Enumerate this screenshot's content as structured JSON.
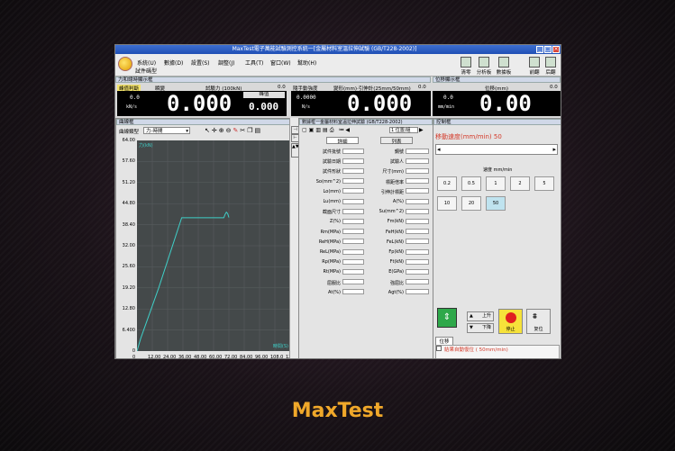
{
  "window": {
    "title": "MaxTest電子萬能試驗測控系統一[金屬材料室溫拉伸試驗 (GB/T228-2002)]"
  },
  "menu": {
    "items": [
      "系統(U)",
      "數據(D)",
      "設置(S)",
      "調整(J)",
      "工具(T)",
      "窗口(W)",
      "幫助(H)"
    ],
    "sub_label": "試件碼型",
    "toolbar": [
      "清零",
      "分析板",
      "數據板",
      "前翻",
      "后翻"
    ]
  },
  "force_section": {
    "title": "力和總時顯示框",
    "mode_button": "峰值判斷",
    "peak_label": "瞬變",
    "force_label": "試驗力 (100kN)",
    "force_zero": "0.0",
    "force_value": "0.000",
    "force_small": "0.0",
    "force_unit": "kN/s",
    "peak_title": "峰值",
    "peak_value": "0.000"
  },
  "deform_section": {
    "mode": "隨手動強度",
    "label": "變形(mm)·引伸計(25mm/50mm)",
    "zero": "0.0",
    "value": "0.000",
    "small": "0.0000",
    "unit": "N/s"
  },
  "disp_section": {
    "title": "位移顯示框",
    "label": "位移(mm)",
    "zero": "0.0",
    "value": "0.00",
    "small": "0.0",
    "unit": "mm/min"
  },
  "curve": {
    "title": "曲線框",
    "type_label": "曲線類型",
    "type_value": "力-時間",
    "y_axis_label": "力(kN)",
    "x_axis_label": "時間(S)",
    "y_ticks": [
      "64.00",
      "57.60",
      "51.20",
      "44.80",
      "38.40",
      "32.00",
      "25.60",
      "19.20",
      "12.80",
      "6.400",
      "0"
    ],
    "x_ticks": [
      "0",
      "12.00",
      "24.00",
      "36.00",
      "48.00",
      "60.00",
      "72.00",
      "84.00",
      "96.00",
      "108.0",
      "120.0"
    ]
  },
  "chart_data": {
    "type": "line",
    "xlabel": "時間(S)",
    "ylabel": "力(kN)",
    "xlim": [
      0,
      120
    ],
    "ylim": [
      0,
      64
    ],
    "grid": true,
    "series": [
      {
        "name": "",
        "x": [
          0,
          3,
          17,
          35,
          57,
          68,
          69,
          70,
          71,
          71.5,
          72
        ],
        "y": [
          0,
          4,
          19.2,
          40.5,
          40.5,
          40.5,
          41.5,
          42.2,
          41.8,
          41.2,
          40.6
        ]
      }
    ]
  },
  "form_section": {
    "title": "數據框一金屬材料室溫拉伸試驗 (GB/T228-2002)",
    "nav_value": "1 位置/組",
    "tabs": [
      "詳細",
      "列表"
    ],
    "left_fields": [
      "試件批號",
      "試驗日期",
      "試件形狀",
      "So(mm^2)",
      "Lo(mm)",
      "Lu(mm)",
      "截面尺寸",
      "Z(%)",
      "Rm(MPa)",
      "ReH(MPa)",
      "ReL(MPa)",
      "Rp(MPa)",
      "Rt(MPa)",
      "屈服比",
      "At(%)"
    ],
    "right_fields": [
      "鋼號",
      "試驗人",
      "尺寸(mm)",
      "標距倍率",
      "引伸計標距",
      "A(%)",
      "Su(mm^2)",
      "Fm(kN)",
      "FeH(kN)",
      "FeL(kN)",
      "Fp(kN)",
      "Ft(kN)",
      "E(GPa)",
      "強屈比",
      "Agt(%)"
    ]
  },
  "control_section": {
    "title": "控制框",
    "speed_label": "移動速度(mm/min) 50",
    "speed_header": "速度 mm/min",
    "speeds": [
      "0.2",
      "0.5",
      "1",
      "2",
      "5",
      "10",
      "20",
      "50"
    ],
    "selected_speed": "50",
    "tab": "位移",
    "up_label": "上升",
    "down_label": "下降",
    "stop_label": "停止",
    "reset_label": "复位",
    "auto_return_label": "結果自動復位 ( 50mm/min)"
  },
  "caption": "MaxTest",
  "colors": {
    "curve": "#3fcfc8",
    "red_label": "#d43a2a",
    "stop": "#e02020",
    "caption": "#f0a82a"
  }
}
